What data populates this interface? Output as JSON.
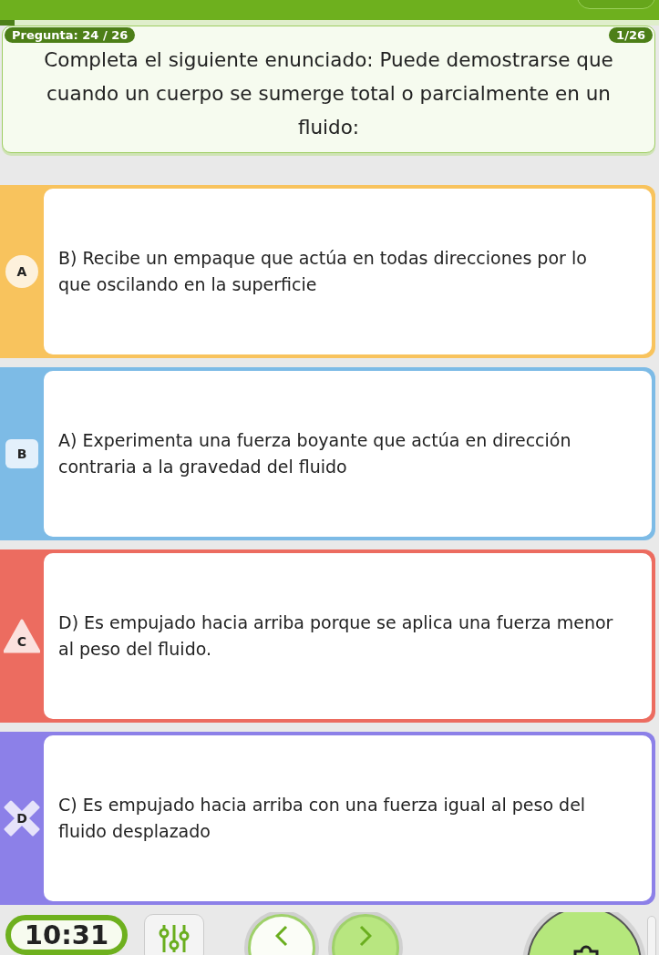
{
  "question": {
    "counter": "Pregunta: 24 / 26",
    "page": "1/26",
    "text": "Completa el siguiente enunciado: Puede demostrarse que cuando un cuerpo se sumerge total o parcialmente en un fluido:"
  },
  "answers": [
    {
      "label": "A",
      "kind": "circle",
      "color": "#f8c35d",
      "text": "B) Recibe un empaque que actúa en todas direcciones por lo que oscilando en la superficie"
    },
    {
      "label": "B",
      "kind": "square",
      "color": "#7dbbe6",
      "text": "A) Experimenta una fuerza boyante que actúa en dirección contraria a la gravedad del fluido"
    },
    {
      "label": "C",
      "kind": "triangle",
      "color": "#ec6c60",
      "text": "D) Es empujado hacia arriba porque se aplica una fuerza menor al peso del fluido."
    },
    {
      "label": "D",
      "kind": "cross",
      "color": "#8c80e8",
      "text": "C) Es empujado hacia arriba con una fuerza igual al peso del fluido desplazado"
    }
  ],
  "timer": "10:31",
  "progress": {
    "level": 0.022
  }
}
